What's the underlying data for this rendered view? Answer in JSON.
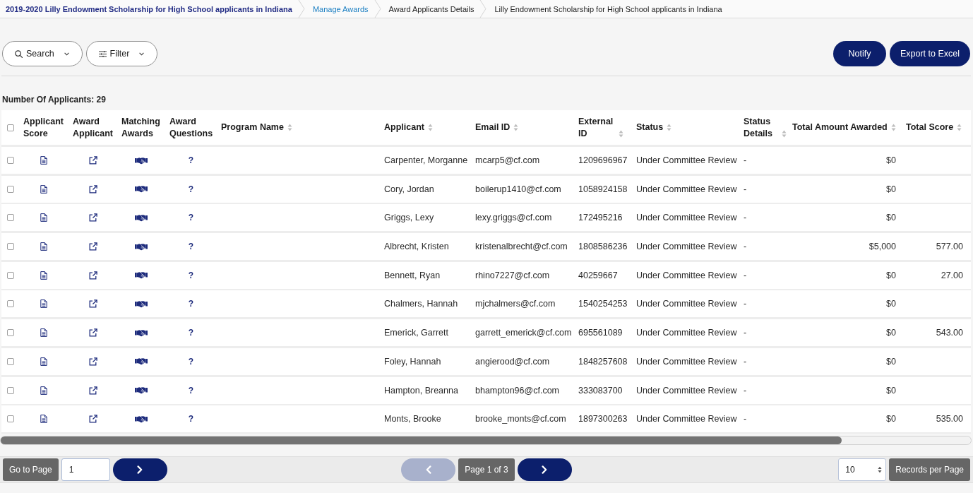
{
  "breadcrumb": [
    {
      "label": "2019-2020 Lilly Endowment Scholarship for High School applicants in Indiana",
      "kind": "title"
    },
    {
      "label": "Manage Awards",
      "kind": "link"
    },
    {
      "label": "Award Applicants Details",
      "kind": "text"
    },
    {
      "label": "Lilly Endowment Scholarship for High School applicants in Indiana",
      "kind": "text"
    }
  ],
  "toolbar": {
    "search": "Search",
    "filter": "Filter",
    "actions": [
      "Notify",
      "Export to Excel"
    ]
  },
  "applicant_count": "Number Of Applicants: 29",
  "table": {
    "select_all_checked": false,
    "columns": [
      {
        "label": "Applicant Score",
        "kind": "score",
        "sortable": false
      },
      {
        "label": "Award Applicant",
        "kind": "award",
        "sortable": false
      },
      {
        "label": "Matching Awards",
        "kind": "matching",
        "sortable": false
      },
      {
        "label": "Award Questions",
        "kind": "questions",
        "sortable": false
      },
      {
        "label": "Program Name",
        "kind": "text",
        "sortable": true
      },
      {
        "label": "Applicant",
        "kind": "text",
        "sortable": true
      },
      {
        "label": "Email ID",
        "kind": "text",
        "sortable": true
      },
      {
        "label": "External ID",
        "kind": "text",
        "sortable": true
      },
      {
        "label": "Status",
        "kind": "text",
        "sortable": true
      },
      {
        "label": "Status Details",
        "kind": "text",
        "sortable": true
      },
      {
        "label": "Total Amount Awarded",
        "kind": "amount",
        "sortable": true
      },
      {
        "label": "Total Score",
        "kind": "amount",
        "sortable": true
      }
    ],
    "rows": [
      {
        "checked": false,
        "question": "?",
        "applicant": "Carpenter, Morganne",
        "email": "mcarp5@cf.com",
        "external_id": "1209696967",
        "status": "Under Committee Review",
        "status_details": "-",
        "total_amount_awarded": "$0"
      },
      {
        "checked": false,
        "question": "?",
        "applicant": "Cory, Jordan",
        "email": "boilerup1410@cf.com",
        "external_id": "1058924158",
        "status": "Under Committee Review",
        "status_details": "-",
        "total_amount_awarded": "$0"
      },
      {
        "checked": false,
        "question": "?",
        "applicant": "Griggs, Lexy",
        "email": "lexy.griggs@cf.com",
        "external_id": "172495216",
        "status": "Under Committee Review",
        "status_details": "-",
        "total_amount_awarded": "$0"
      },
      {
        "checked": false,
        "question": "?",
        "applicant": "Albrecht, Kristen",
        "email": "kristenalbrecht@cf.com",
        "external_id": "1808586236",
        "status": "Under Committee Review",
        "status_details": "-",
        "total_amount_awarded": "$5,000",
        "total_score": "577.00"
      },
      {
        "checked": false,
        "question": "?",
        "applicant": "Bennett, Ryan",
        "email": "rhino7227@cf.com",
        "external_id": "40259667",
        "status": "Under Committee Review",
        "status_details": "-",
        "total_amount_awarded": "$0",
        "total_score": "27.00"
      },
      {
        "checked": false,
        "question": "?",
        "applicant": "Chalmers, Hannah",
        "email": "mjchalmers@cf.com",
        "external_id": "1540254253",
        "status": "Under Committee Review",
        "status_details": "-",
        "total_amount_awarded": "$0"
      },
      {
        "checked": false,
        "question": "?",
        "applicant": "Emerick, Garrett",
        "email": "garrett_emerick@cf.com",
        "external_id": "695561089",
        "status": "Under Committee Review",
        "status_details": "-",
        "total_amount_awarded": "$0",
        "total_score": "543.00"
      },
      {
        "checked": false,
        "question": "?",
        "applicant": "Foley, Hannah",
        "email": "angierood@cf.com",
        "external_id": "1848257608",
        "status": "Under Committee Review",
        "status_details": "-",
        "total_amount_awarded": "$0"
      },
      {
        "checked": false,
        "question": "?",
        "applicant": "Hampton, Breanna",
        "email": "bhampton96@cf.com",
        "external_id": "333083700",
        "status": "Under Committee Review",
        "status_details": "-",
        "total_amount_awarded": "$0"
      },
      {
        "checked": false,
        "question": "?",
        "applicant": "Monts, Brooke",
        "email": "brooke_monts@cf.com",
        "external_id": "1897300263",
        "status": "Under Committee Review",
        "status_details": "-",
        "total_amount_awarded": "$0",
        "total_score": "535.00"
      }
    ]
  },
  "pagination": {
    "go_to_page": "Go to Page",
    "page_input": "1",
    "page_info": "Page 1 of 3",
    "previous_disabled": true,
    "next_disabled": false,
    "records_per_page": "10",
    "records_label": "Records per Page"
  }
}
